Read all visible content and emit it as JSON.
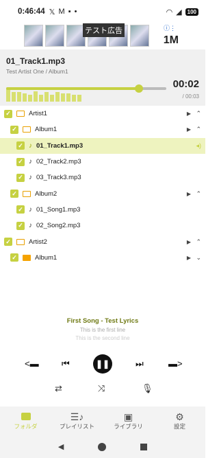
{
  "status_bar": {
    "time": "0:46:44",
    "icons": [
      "x-icon",
      "gmail-icon",
      "tv-icon",
      "dot"
    ],
    "battery": "100"
  },
  "ad": {
    "label": "テスト広告",
    "brand": "1M"
  },
  "now_playing": {
    "title": "01_Track1.mp3",
    "artist_album": "Test Artist One / Album1",
    "current_time": "00:02",
    "total_time": "/ 00:03",
    "progress": 0.83,
    "eq_levels": [
      0.55,
      0.4,
      0.4,
      0.35,
      0.3,
      0.45,
      0.3,
      0.4,
      0.3,
      0.4,
      0.35,
      0.35,
      0.3,
      0.3
    ]
  },
  "tree": [
    {
      "type": "folder",
      "indent": 0,
      "label": "Artist1",
      "expanded": true
    },
    {
      "type": "folder",
      "indent": 1,
      "label": "Album1",
      "expanded": true
    },
    {
      "type": "file",
      "indent": 2,
      "label": "01_Track1.mp3",
      "active": true
    },
    {
      "type": "file",
      "indent": 2,
      "label": "02_Track2.mp3"
    },
    {
      "type": "file",
      "indent": 2,
      "label": "03_Track3.mp3"
    },
    {
      "type": "folder",
      "indent": 1,
      "label": "Album2",
      "expanded": true
    },
    {
      "type": "file",
      "indent": 2,
      "label": "01_Song1.mp3"
    },
    {
      "type": "file",
      "indent": 2,
      "label": "02_Song2.mp3"
    },
    {
      "type": "folder",
      "indent": 0,
      "label": "Artist2",
      "expanded": true
    },
    {
      "type": "folder",
      "indent": 1,
      "label": "Album1",
      "expanded": false,
      "filled": true
    }
  ],
  "lyrics": {
    "title": "First Song - Test Lyrics",
    "line1": "This is the first line",
    "line2": "This is the second line"
  },
  "bottom_nav": [
    {
      "label": "フォルダ",
      "icon": "folder-icon",
      "selected": true
    },
    {
      "label": "プレイリスト",
      "icon": "playlist-icon"
    },
    {
      "label": "ライブラリ",
      "icon": "library-icon"
    },
    {
      "label": "設定",
      "icon": "gear-icon"
    }
  ],
  "colors": {
    "accent": "#c6d142",
    "active_row": "#eef3bf",
    "lyrics_title": "#6f7a14"
  }
}
